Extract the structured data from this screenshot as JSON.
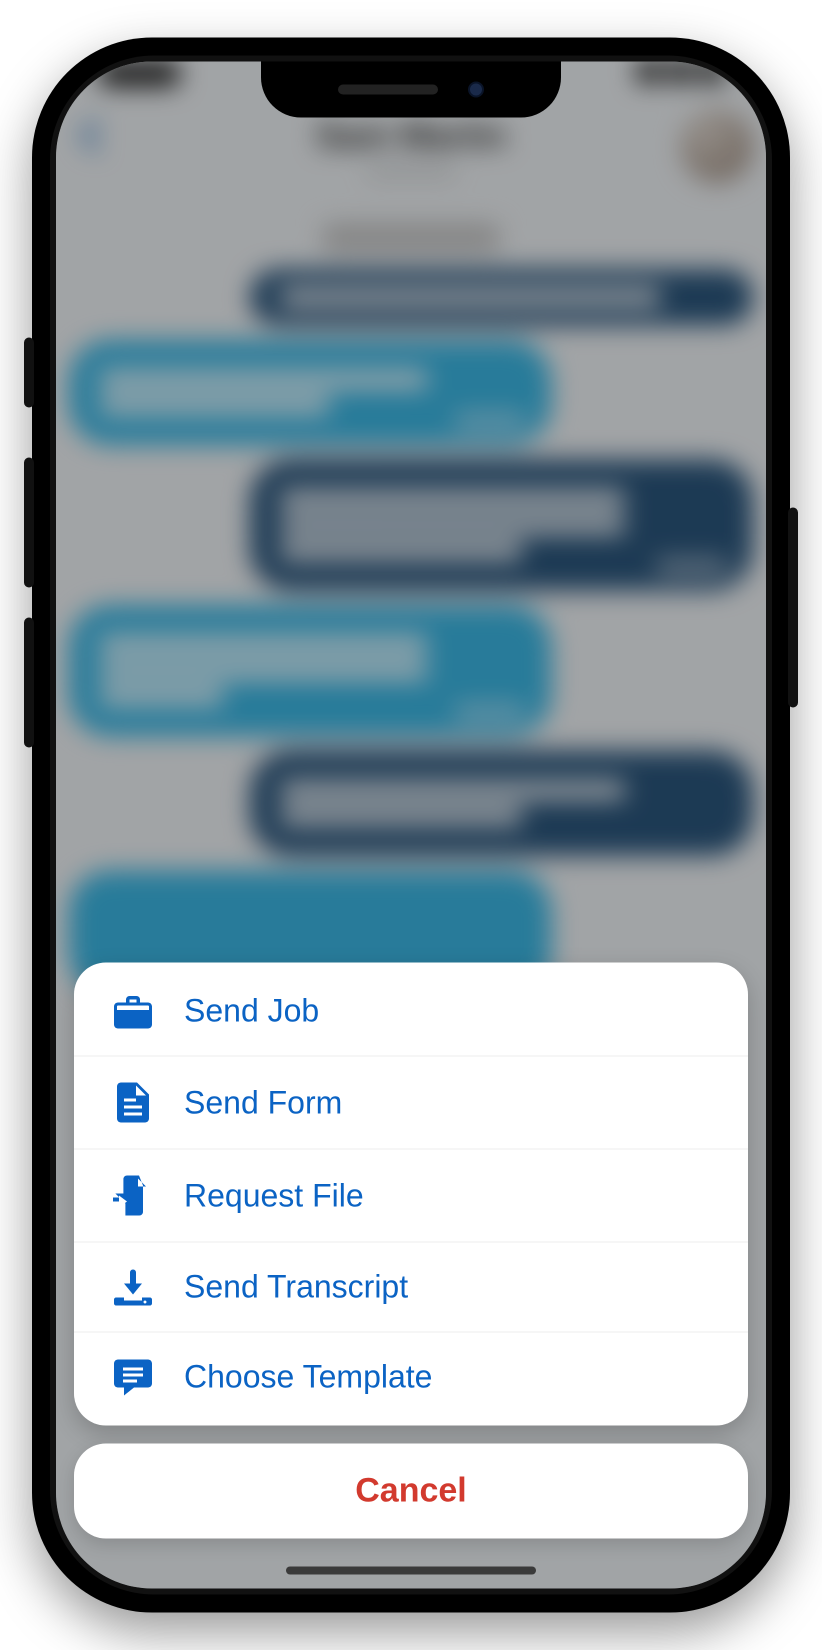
{
  "colors": {
    "accent": "#0b63c4",
    "danger": "#d23a2e",
    "bubble_out": "#1d4a72",
    "bubble_in": "#2eaedd"
  },
  "header": {
    "title": "Sam Martin"
  },
  "action_sheet": {
    "items": [
      {
        "icon": "briefcase-icon",
        "label": "Send Job"
      },
      {
        "icon": "document-icon",
        "label": "Send Form"
      },
      {
        "icon": "file-import-icon",
        "label": "Request File"
      },
      {
        "icon": "download-icon",
        "label": "Send Transcript"
      },
      {
        "icon": "chat-template-icon",
        "label": "Choose Template"
      }
    ],
    "cancel_label": "Cancel"
  }
}
